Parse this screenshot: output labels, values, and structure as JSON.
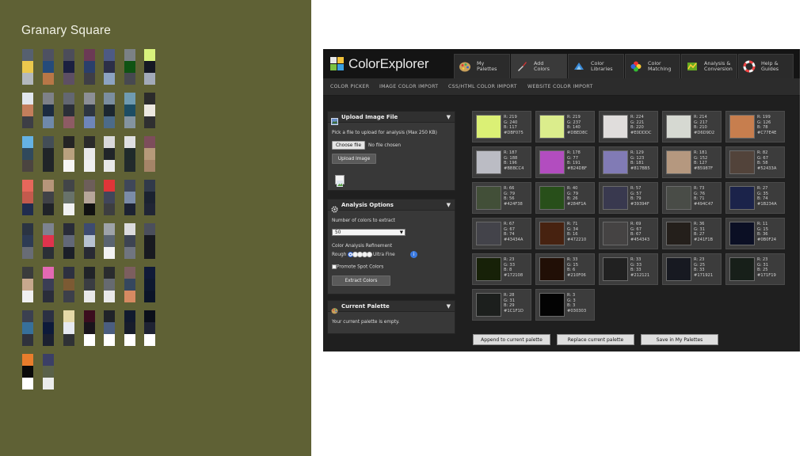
{
  "left": {
    "title": "Granary Square",
    "palettes": [
      [
        "#566070",
        "#ebc84d",
        "#b3b8bd"
      ],
      [
        "#4e5162",
        "#254b7a",
        "#b87747"
      ],
      [
        "#4c4d5a",
        "#1b2040",
        "#5d4f64"
      ],
      [
        "#6b3a55",
        "#2a3f6b",
        "#3e3e46"
      ],
      [
        "#4d5a84",
        "#2c2f48",
        "#8ca3c2"
      ],
      [
        "#7b8186",
        "#0f5313",
        "#474950"
      ],
      [
        "#d8f27c",
        "#151823",
        "#a2aab9"
      ],
      [
        "#e2e7ee",
        "#c37e5c",
        "#3d3e45"
      ],
      [
        "#7e8188",
        "#1c2b40",
        "#6f89aa"
      ],
      [
        "#636772",
        "#2b2f38",
        "#8e5b64"
      ],
      [
        "#8c8f96",
        "#2d3540",
        "#6e86b8"
      ],
      [
        "#7b8ea0",
        "#1c2730",
        "#4c6b89"
      ],
      [
        "#6f9bb1",
        "#1d4d63",
        "#8494a0"
      ],
      [
        "#2b2b2b",
        "#ece8e0",
        "#2f2f30"
      ],
      [
        "#65b2e4",
        "#30495c",
        "#4b4440"
      ],
      [
        "#434d56",
        "#202428",
        "#202428"
      ],
      [
        "#242424",
        "#b9a17f",
        "#f7f6f4"
      ],
      [
        "#2a2a2a",
        "#e8e8ea",
        "#f0f0f1"
      ],
      [
        "#d9d9db",
        "#202428",
        "#e8e8e8"
      ],
      [
        "#dfe0e2",
        "#1f2a2a",
        "#222a2c"
      ],
      [
        "#7d4d5b",
        "#b69a7a",
        "#a58468"
      ],
      [
        "#e6675b",
        "#c45a4d",
        "#202c4e"
      ],
      [
        "#b6957a",
        "#404247",
        "#202328"
      ],
      [
        "#424548",
        "#68726a",
        "#f1f1f1"
      ],
      [
        "#6d5e5a",
        "#b7a69a",
        "#111111"
      ],
      [
        "#e03538",
        "#41465a",
        "#3d3e40"
      ],
      [
        "#3f4759",
        "#7b8ca8",
        "#1c2232"
      ],
      [
        "#313a4a",
        "#1b2230",
        "#202535"
      ],
      [
        "#2b3442",
        "#2d3b54",
        "#686c75"
      ],
      [
        "#7d8390",
        "#e0334d",
        "#2a2f36"
      ],
      [
        "#292c38",
        "#626878",
        "#1b1f28"
      ],
      [
        "#3d4b70",
        "#b7c2d1",
        "#282a33"
      ],
      [
        "#9ea3a9",
        "#5a6470",
        "#f2f2f2"
      ],
      [
        "#dbdbdd",
        "#3d4452",
        "#707580"
      ],
      [
        "#4b4f5c",
        "#181a20",
        "#181a20"
      ],
      [
        "#3a3c3c",
        "#c7a88e",
        "#f0f0f0"
      ],
      [
        "#e369b3",
        "#3a3d55",
        "#2a2d3a"
      ],
      [
        "#2d3040",
        "#7c5a33",
        "#3c3f4a"
      ],
      [
        "#202328",
        "#3a3d42",
        "#e8e8e8"
      ],
      [
        "#2a2c2e",
        "#666a70",
        "#e9e9e9"
      ],
      [
        "#7c5e5f",
        "#35475e",
        "#d68a62"
      ],
      [
        "#101a38",
        "#0e1930",
        "#0b1428"
      ],
      [
        "#3b4050",
        "#37709a",
        "#2f323c"
      ],
      [
        "#2b3043",
        "#0d1a3a",
        "#1b2030"
      ],
      [
        "#e5d9a8",
        "#e6e9f0",
        "#2f3135"
      ],
      [
        "#3b0d1e",
        "#19141b",
        "#ffffff"
      ],
      [
        "#202329",
        "#4b5e80",
        "#ffffff"
      ],
      [
        "#111a2e",
        "#171d2b",
        "#ffffff"
      ],
      [
        "#0b0f1a",
        "#1f2333",
        "#ffffff"
      ],
      [
        "#e87d2c",
        "#0a0a0a",
        "#ffffff"
      ],
      [
        "#3b3f66",
        "#5a6149",
        "#ebecec"
      ]
    ]
  },
  "app": {
    "logo": "ColorExplorer",
    "tabs": [
      {
        "label": "My\nPalettes",
        "icon": "palette-icon"
      },
      {
        "label": "Add\nColors",
        "icon": "brush-icon"
      },
      {
        "label": "Color\nLibraries",
        "icon": "library-icon"
      },
      {
        "label": "Color\nMatching",
        "icon": "color-wheel-icon"
      },
      {
        "label": "Analysis &\nConversion",
        "icon": "analysis-icon"
      },
      {
        "label": "Help &\nGuides",
        "icon": "lifebuoy-icon"
      }
    ],
    "subnav": [
      "COLOR PICKER",
      "IMAGE COLOR IMPORT",
      "CSS/HTML COLOR IMPORT",
      "WEBSITE COLOR IMPORT"
    ],
    "upload": {
      "title": "Upload Image File",
      "instruction": "Pick a file to upload for analysis (Max 250 KB)",
      "choose_label": "Choose file",
      "no_file": "No file chosen",
      "upload_label": "Upload Image"
    },
    "analysis": {
      "title": "Analysis Options",
      "count_label": "Number of colors to extract",
      "count_value": "50",
      "refine_label": "Color Analysis Refinement",
      "rough": "Rough",
      "ultra": "Ultra Fine",
      "spot_label": "Promote Spot Colors",
      "extract_label": "Extract Colors"
    },
    "current": {
      "title": "Current Palette",
      "empty": "Your current palette is empty."
    },
    "swatches": [
      {
        "hex": "#DBF075",
        "r": "R: 219",
        "g": "G: 240",
        "b": "B: 117",
        "h": "#DBF075"
      },
      {
        "hex": "#DBED8C",
        "r": "R: 219",
        "g": "G: 237",
        "b": "B: 140",
        "h": "#DBED8C"
      },
      {
        "hex": "#E0DDDC",
        "r": "R: 224",
        "g": "G: 221",
        "b": "B: 220",
        "h": "#E0DDDC"
      },
      {
        "hex": "#D6D9D2",
        "r": "R: 214",
        "g": "G: 217",
        "b": "B: 210",
        "h": "#D6D9D2"
      },
      {
        "hex": "#C77E4E",
        "r": "R: 199",
        "g": "G: 126",
        "b": "B: 78",
        "h": "#C77E4E"
      },
      {
        "hex": "#BBBCC4",
        "r": "R: 187",
        "g": "G: 188",
        "b": "B: 196",
        "h": "#BBBCC4"
      },
      {
        "hex": "#B24DBF",
        "r": "R: 178",
        "g": "G: 77",
        "b": "B: 191",
        "h": "#B24DBF"
      },
      {
        "hex": "#817BB5",
        "r": "R: 129",
        "g": "G: 123",
        "b": "B: 181",
        "h": "#817BB5"
      },
      {
        "hex": "#B5987F",
        "r": "R: 181",
        "g": "G: 152",
        "b": "B: 127",
        "h": "#B5987F"
      },
      {
        "hex": "#52433A",
        "r": "R: 82",
        "g": "G: 67",
        "b": "B: 58",
        "h": "#52433A"
      },
      {
        "hex": "#424F38",
        "r": "R: 66",
        "g": "G: 79",
        "b": "B: 56",
        "h": "#424F38"
      },
      {
        "hex": "#284F1A",
        "r": "R: 40",
        "g": "G: 79",
        "b": "B: 26",
        "h": "#284F1A"
      },
      {
        "hex": "#39394F",
        "r": "R: 57",
        "g": "G: 57",
        "b": "B: 79",
        "h": "#39394F"
      },
      {
        "hex": "#494C47",
        "r": "R: 73",
        "g": "G: 76",
        "b": "B: 71",
        "h": "#494C47"
      },
      {
        "hex": "#1B234A",
        "r": "R: 27",
        "g": "G: 35",
        "b": "B: 74",
        "h": "#1B234A"
      },
      {
        "hex": "#43434A",
        "r": "R: 67",
        "g": "G: 67",
        "b": "B: 74",
        "h": "#43434A"
      },
      {
        "hex": "#472210",
        "r": "R: 71",
        "g": "G: 34",
        "b": "B: 16",
        "h": "#472210"
      },
      {
        "hex": "#454343",
        "r": "R: 69",
        "g": "G: 67",
        "b": "B: 67",
        "h": "#454343"
      },
      {
        "hex": "#241F1B",
        "r": "R: 36",
        "g": "G: 31",
        "b": "B: 27",
        "h": "#241F1B"
      },
      {
        "hex": "#0B0F24",
        "r": "R: 11",
        "g": "G: 15",
        "b": "B: 36",
        "h": "#0B0F24"
      },
      {
        "hex": "#172108",
        "r": "R: 23",
        "g": "G: 33",
        "b": "B: 8",
        "h": "#172108"
      },
      {
        "hex": "#210F06",
        "r": "R: 33",
        "g": "G: 15",
        "b": "B: 6",
        "h": "#210F06"
      },
      {
        "hex": "#212121",
        "r": "R: 33",
        "g": "G: 33",
        "b": "B: 33",
        "h": "#212121"
      },
      {
        "hex": "#171921",
        "r": "R: 23",
        "g": "G: 25",
        "b": "B: 33",
        "h": "#171921"
      },
      {
        "hex": "#171F19",
        "r": "R: 23",
        "g": "G: 31",
        "b": "B: 25",
        "h": "#171F19"
      },
      {
        "hex": "#1C1F1D",
        "r": "R: 28",
        "g": "G: 31",
        "b": "B: 29",
        "h": "#1C1F1D"
      },
      {
        "hex": "#030303",
        "r": "R: 3",
        "g": "G: 3",
        "b": "B: 3",
        "h": "#030303"
      }
    ],
    "actions": [
      "Append to current palette",
      "Replace current palette",
      "Save in My Palettes"
    ]
  }
}
